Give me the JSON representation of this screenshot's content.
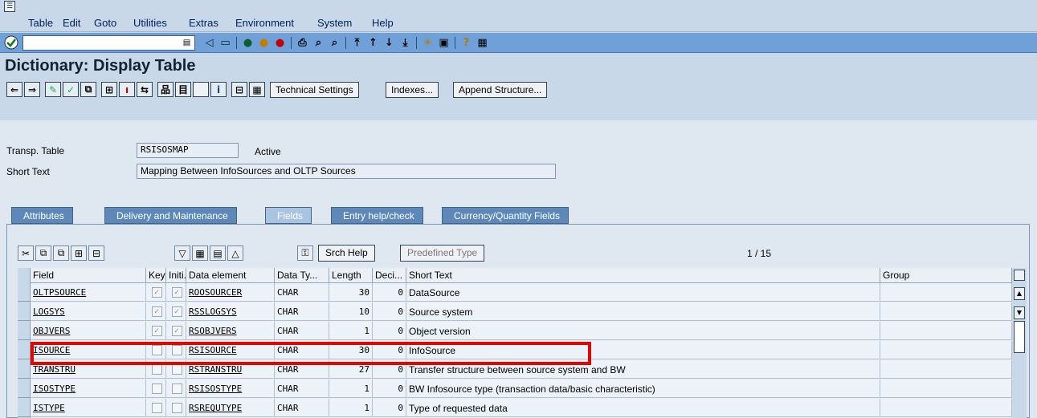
{
  "menu": [
    "Table",
    "Edit",
    "Goto",
    "Utilities",
    "Extras",
    "Environment",
    "System",
    "Help"
  ],
  "title": "Dictionary: Display Table",
  "app_buttons": {
    "technical_settings": "Technical Settings",
    "indexes": "Indexes...",
    "append_structure": "Append Structure..."
  },
  "header": {
    "table_label": "Transp. Table",
    "table_value": "RSISOSMAP",
    "status": "Active",
    "short_text_label": "Short Text",
    "short_text_value": "Mapping Between InfoSources and OLTP Sources"
  },
  "tabs": [
    "Attributes",
    "Delivery and Maintenance",
    "Fields",
    "Entry help/check",
    "Currency/Quantity Fields"
  ],
  "table_toolbar": {
    "srch_help": "Srch Help",
    "predefined_type": "Predefined Type",
    "counter": "1  /  15"
  },
  "columns": [
    "Field",
    "Key",
    "Initi...",
    "Data element",
    "Data Ty...",
    "Length",
    "Deci...",
    "Short Text",
    "Group"
  ],
  "rows": [
    {
      "field": "OLTPSOURCE",
      "key": true,
      "init": true,
      "elem": "ROOSOURCER",
      "type": "CHAR",
      "len": "30",
      "dec": "0",
      "text": "DataSource",
      "group": ""
    },
    {
      "field": "LOGSYS",
      "key": true,
      "init": true,
      "elem": "RSSLOGSYS",
      "type": "CHAR",
      "len": "10",
      "dec": "0",
      "text": "Source system",
      "group": ""
    },
    {
      "field": "OBJVERS",
      "key": true,
      "init": true,
      "elem": "RSOBJVERS",
      "type": "CHAR",
      "len": "1",
      "dec": "0",
      "text": "Object version",
      "group": ""
    },
    {
      "field": "ISOURCE",
      "key": false,
      "init": false,
      "elem": "RSISOURCE",
      "type": "CHAR",
      "len": "30",
      "dec": "0",
      "text": "InfoSource",
      "group": ""
    },
    {
      "field": "TRANSTRU",
      "key": false,
      "init": false,
      "elem": "RSTRANSTRU",
      "type": "CHAR",
      "len": "27",
      "dec": "0",
      "text": "Transfer structure between source system and BW",
      "group": ""
    },
    {
      "field": "ISOSTYPE",
      "key": false,
      "init": false,
      "elem": "RSISOSTYPE",
      "type": "CHAR",
      "len": "1",
      "dec": "0",
      "text": "BW Infosource type (transaction data/basic characteristic)",
      "group": ""
    },
    {
      "field": "ISTYPE",
      "key": false,
      "init": false,
      "elem": "RSREQUTYPE",
      "type": "CHAR",
      "len": "1",
      "dec": "0",
      "text": "Type of requested data",
      "group": ""
    }
  ],
  "colors": {
    "toolbar": "#6fa0d8",
    "background": "#dfe8f1",
    "highlight": "#e10600",
    "tab": "#5e88b8"
  }
}
